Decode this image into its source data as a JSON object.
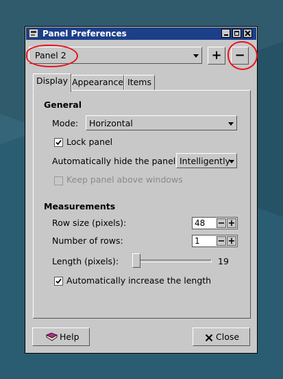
{
  "window": {
    "title": "Panel Preferences",
    "icon": "panel-preferences-icon",
    "buttons": [
      "minimize-icon",
      "maximize-icon",
      "close-icon"
    ]
  },
  "panel_select": {
    "value": "Panel 2",
    "add_label": "+",
    "remove_label": "−"
  },
  "annotations": {
    "color": "#e8141c",
    "items": [
      "panel-select-circle",
      "remove-panel-circle"
    ]
  },
  "tabs": [
    {
      "label": "Display",
      "active": true
    },
    {
      "label": "Appearance",
      "active": false
    },
    {
      "label": "Items",
      "active": false
    }
  ],
  "general": {
    "heading": "General",
    "mode_label": "Mode:",
    "mode_value": "Horizontal",
    "lock_label": "Lock panel",
    "lock_checked": true,
    "autohide_label": "Automatically hide the panel:",
    "autohide_value": "Intelligently",
    "keep_above_label": "Keep panel above windows",
    "keep_above_checked": false,
    "keep_above_enabled": false
  },
  "measurements": {
    "heading": "Measurements",
    "row_size_label": "Row size (pixels):",
    "row_size_value": "48",
    "rows_label": "Number of rows:",
    "rows_value": "1",
    "length_label": "Length (pixels):",
    "length_value": "19",
    "auto_increase_label": "Automatically increase the length",
    "auto_increase_checked": true
  },
  "footer": {
    "help_label": "Help",
    "close_label": "Close"
  }
}
